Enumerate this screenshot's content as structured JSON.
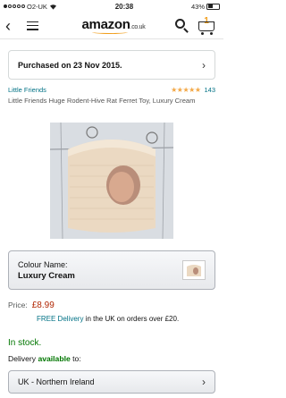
{
  "status_bar": {
    "carrier": "O2-UK",
    "time": "20:38",
    "battery_percent": "43%",
    "battery_level": 0.43
  },
  "nav": {
    "logo_main": "amazon",
    "logo_suffix": ".co.uk",
    "cart_count": "1",
    "accent_color": "#f19e1c"
  },
  "purchase": {
    "text": "Purchased on 23 Nov 2015."
  },
  "product": {
    "brand": "Little Friends",
    "rating_stars": 4.5,
    "rating_count": "143",
    "title": "Little Friends Huge Rodent-Hive Rat Ferret Toy, Luxury Cream"
  },
  "colour": {
    "label": "Colour Name:",
    "value": "Luxury Cream"
  },
  "pricing": {
    "label": "Price:",
    "value": "£8.99",
    "delivery_free": "FREE Delivery",
    "delivery_rest": " in the UK on orders over £20."
  },
  "stock": {
    "status": "In stock."
  },
  "availability": {
    "prefix": "Delivery ",
    "highlight": "available",
    "suffix": " to:"
  },
  "region": {
    "value": "UK - Northern Ireland"
  }
}
